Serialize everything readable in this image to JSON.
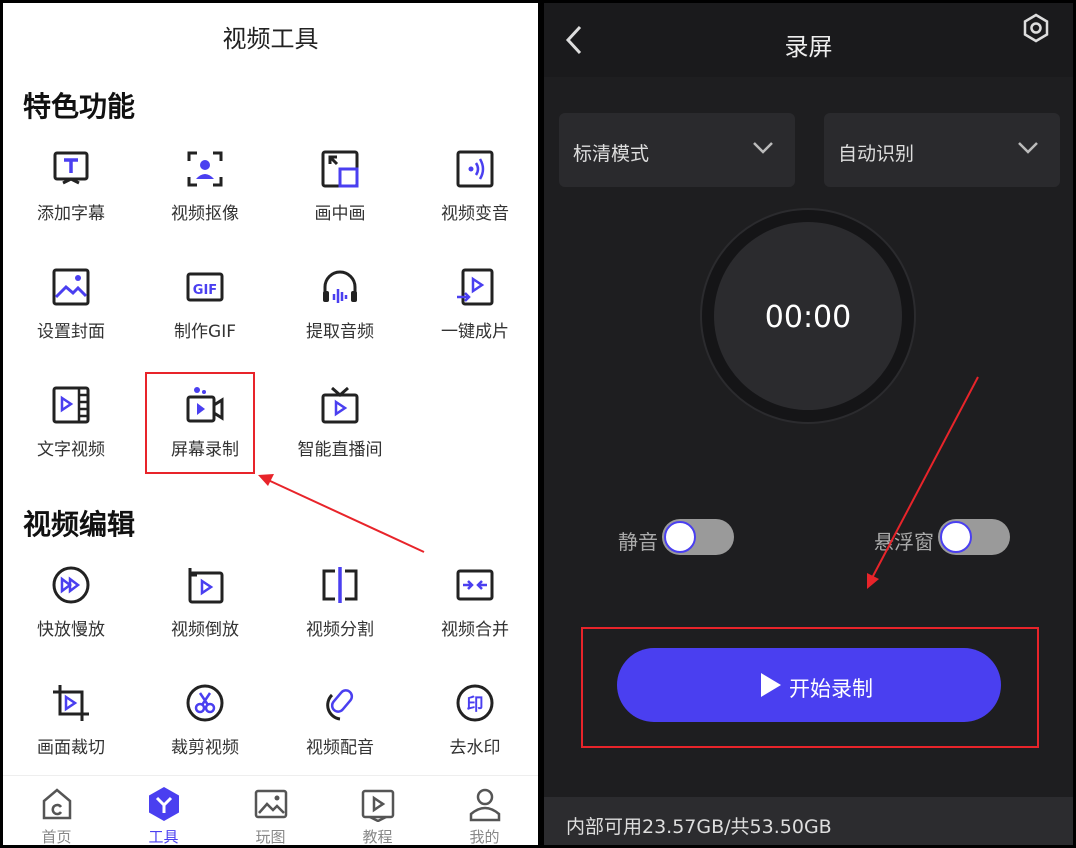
{
  "left": {
    "title": "视频工具",
    "sections": [
      {
        "title": "特色功能",
        "items": [
          {
            "label": "添加字幕",
            "icon": "subtitle-icon"
          },
          {
            "label": "视频抠像",
            "icon": "portrait-cutout-icon"
          },
          {
            "label": "画中画",
            "icon": "picture-in-picture-icon"
          },
          {
            "label": "视频变音",
            "icon": "voice-change-icon"
          },
          {
            "label": "设置封面",
            "icon": "cover-image-icon"
          },
          {
            "label": "制作GIF",
            "icon": "gif-icon"
          },
          {
            "label": "提取音频",
            "icon": "headphones-icon"
          },
          {
            "label": "一键成片",
            "icon": "one-click-video-icon"
          },
          {
            "label": "文字视频",
            "icon": "text-video-icon"
          },
          {
            "label": "屏幕录制",
            "icon": "screen-record-icon"
          },
          {
            "label": "智能直播间",
            "icon": "live-tv-icon"
          }
        ]
      },
      {
        "title": "视频编辑",
        "items": [
          {
            "label": "快放慢放",
            "icon": "speed-icon"
          },
          {
            "label": "视频倒放",
            "icon": "reverse-icon"
          },
          {
            "label": "视频分割",
            "icon": "split-icon"
          },
          {
            "label": "视频合并",
            "icon": "merge-icon"
          },
          {
            "label": "画面裁切",
            "icon": "crop-icon"
          },
          {
            "label": "裁剪视频",
            "icon": "trim-icon"
          },
          {
            "label": "视频配音",
            "icon": "dubbing-icon"
          },
          {
            "label": "去水印",
            "icon": "watermark-remove-icon"
          }
        ]
      }
    ],
    "tabs": [
      {
        "label": "首页",
        "icon": "home-icon",
        "active": false
      },
      {
        "label": "工具",
        "icon": "tools-icon",
        "active": true
      },
      {
        "label": "玩图",
        "icon": "image-icon",
        "active": false
      },
      {
        "label": "教程",
        "icon": "tutorial-icon",
        "active": false
      },
      {
        "label": "我的",
        "icon": "profile-icon",
        "active": false
      }
    ]
  },
  "right": {
    "title": "录屏",
    "quality_select": "标清模式",
    "orientation_select": "自动识别",
    "timer": "00:00",
    "toggles": [
      {
        "label": "静音",
        "on": false
      },
      {
        "label": "悬浮窗",
        "on": false
      }
    ],
    "start_label": "开始录制",
    "storage": "内部可用23.57GB/共53.50GB"
  },
  "colors": {
    "accent": "#4a3ff0",
    "highlight": "#e8242a",
    "dark_bg": "#1e1e20"
  }
}
